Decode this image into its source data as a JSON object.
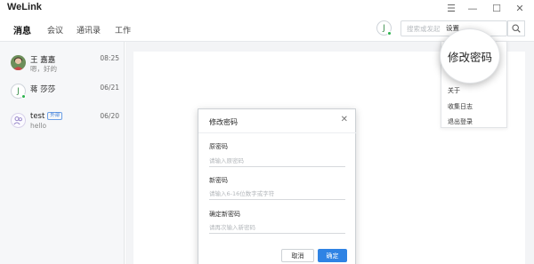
{
  "app": {
    "title": "WeLink"
  },
  "window_controls": {
    "menu": "☰",
    "minimize": "—",
    "maximize": "☐",
    "close": "✕"
  },
  "nav": {
    "tabs": [
      {
        "label": "消息",
        "active": true
      },
      {
        "label": "会议",
        "active": false
      },
      {
        "label": "通讯录",
        "active": false
      },
      {
        "label": "工作",
        "active": false
      }
    ],
    "avatar_letter": "J",
    "search_placeholder": "搜索或发起",
    "settings_label": "设置"
  },
  "conversations": [
    {
      "name": "王 嘉嘉",
      "preview": "嗯，好的",
      "time": "08:25",
      "avatar": "photo"
    },
    {
      "name": "蒋 莎莎",
      "preview": "",
      "time": "06/21",
      "avatar": "J"
    },
    {
      "name": "test",
      "badge": "外部",
      "preview": "hello",
      "time": "06/20",
      "avatar": "group"
    }
  ],
  "watermark": "ink",
  "settings_menu": {
    "highlight": "修改密码",
    "items": [
      "关于",
      "收集日志",
      "退出登录"
    ]
  },
  "dialog": {
    "title": "修改密码",
    "close": "✕",
    "fields": [
      {
        "label": "原密码",
        "placeholder": "请输入原密码"
      },
      {
        "label": "新密码",
        "placeholder": "请输入6-16位数字或字符"
      },
      {
        "label": "确定新密码",
        "placeholder": "请再次输入新密码"
      }
    ],
    "cancel": "取消",
    "confirm": "确定"
  },
  "colors": {
    "accent": "#2f83e4",
    "online": "#2bb24c"
  }
}
